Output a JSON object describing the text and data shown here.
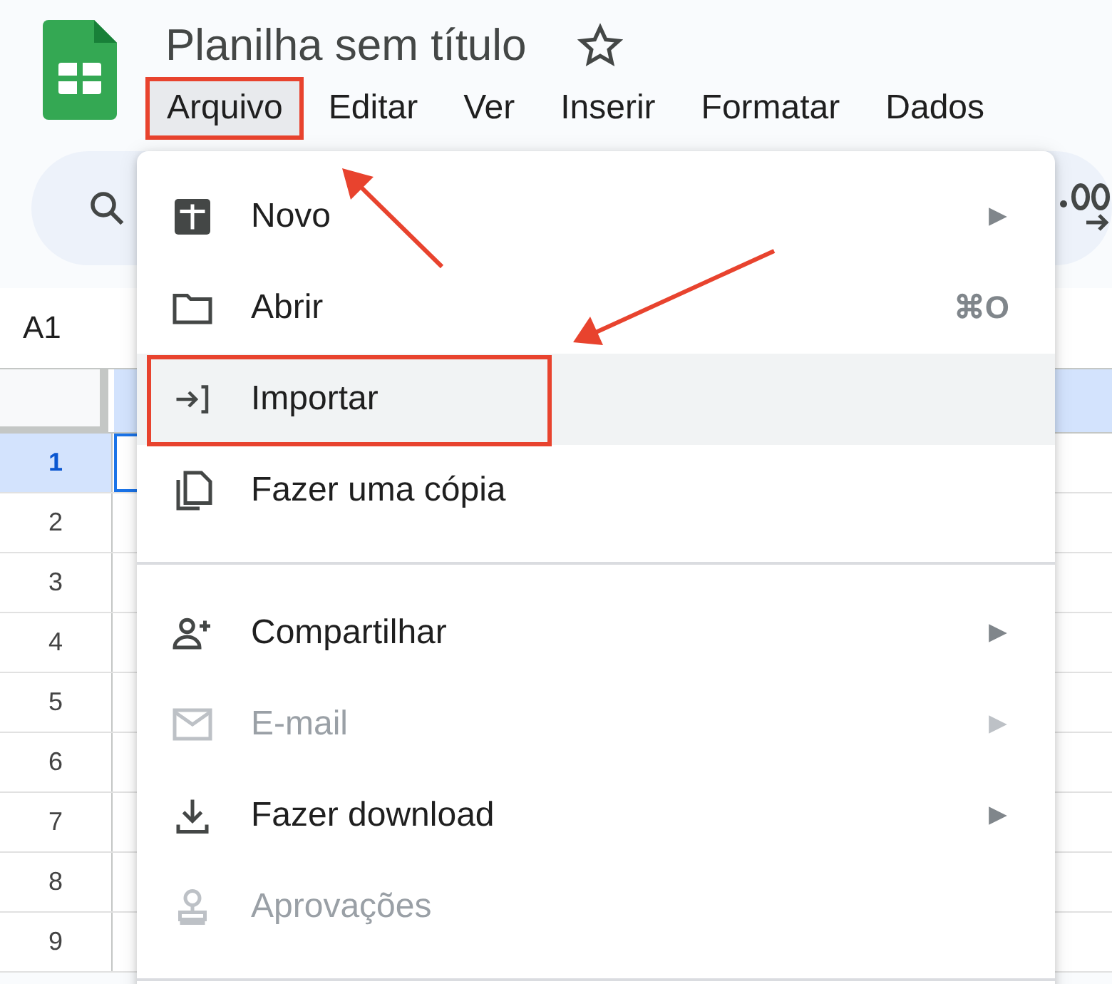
{
  "document": {
    "title": "Planilha sem título",
    "starred": false
  },
  "menu_bar": [
    {
      "label": "Arquivo",
      "selected": true,
      "highlighted": true
    },
    {
      "label": "Editar",
      "selected": false,
      "highlighted": false
    },
    {
      "label": "Ver",
      "selected": false,
      "highlighted": false
    },
    {
      "label": "Inserir",
      "selected": false,
      "highlighted": false
    },
    {
      "label": "Formatar",
      "selected": false,
      "highlighted": false
    },
    {
      "label": "Dados",
      "selected": false,
      "highlighted": false
    }
  ],
  "name_box": {
    "value": "A1"
  },
  "grid": {
    "rows": [
      {
        "label": "1",
        "selected": true
      },
      {
        "label": "2",
        "selected": false
      },
      {
        "label": "3",
        "selected": false
      },
      {
        "label": "4",
        "selected": false
      },
      {
        "label": "5",
        "selected": false
      },
      {
        "label": "6",
        "selected": false
      },
      {
        "label": "7",
        "selected": false
      },
      {
        "label": "8",
        "selected": false
      },
      {
        "label": "9",
        "selected": false
      }
    ]
  },
  "file_menu": {
    "groups": [
      [
        {
          "label": "Novo",
          "submenu": true,
          "disabled": false,
          "selected": false,
          "highlighted": false
        },
        {
          "label": "Abrir",
          "shortcut": "⌘O",
          "submenu": false,
          "disabled": false,
          "selected": false,
          "highlighted": false
        },
        {
          "label": "Importar",
          "submenu": false,
          "disabled": false,
          "selected": true,
          "highlighted": true
        },
        {
          "label": "Fazer uma cópia",
          "submenu": false,
          "disabled": false,
          "selected": false,
          "highlighted": false
        }
      ],
      [
        {
          "label": "Compartilhar",
          "submenu": true,
          "disabled": false,
          "selected": false,
          "highlighted": false
        },
        {
          "label": "E-mail",
          "submenu": true,
          "disabled": true,
          "selected": false,
          "highlighted": false
        },
        {
          "label": "Fazer download",
          "submenu": true,
          "disabled": false,
          "selected": false,
          "highlighted": false
        },
        {
          "label": "Aprovações",
          "submenu": false,
          "disabled": true,
          "selected": false,
          "highlighted": false
        }
      ]
    ]
  }
}
